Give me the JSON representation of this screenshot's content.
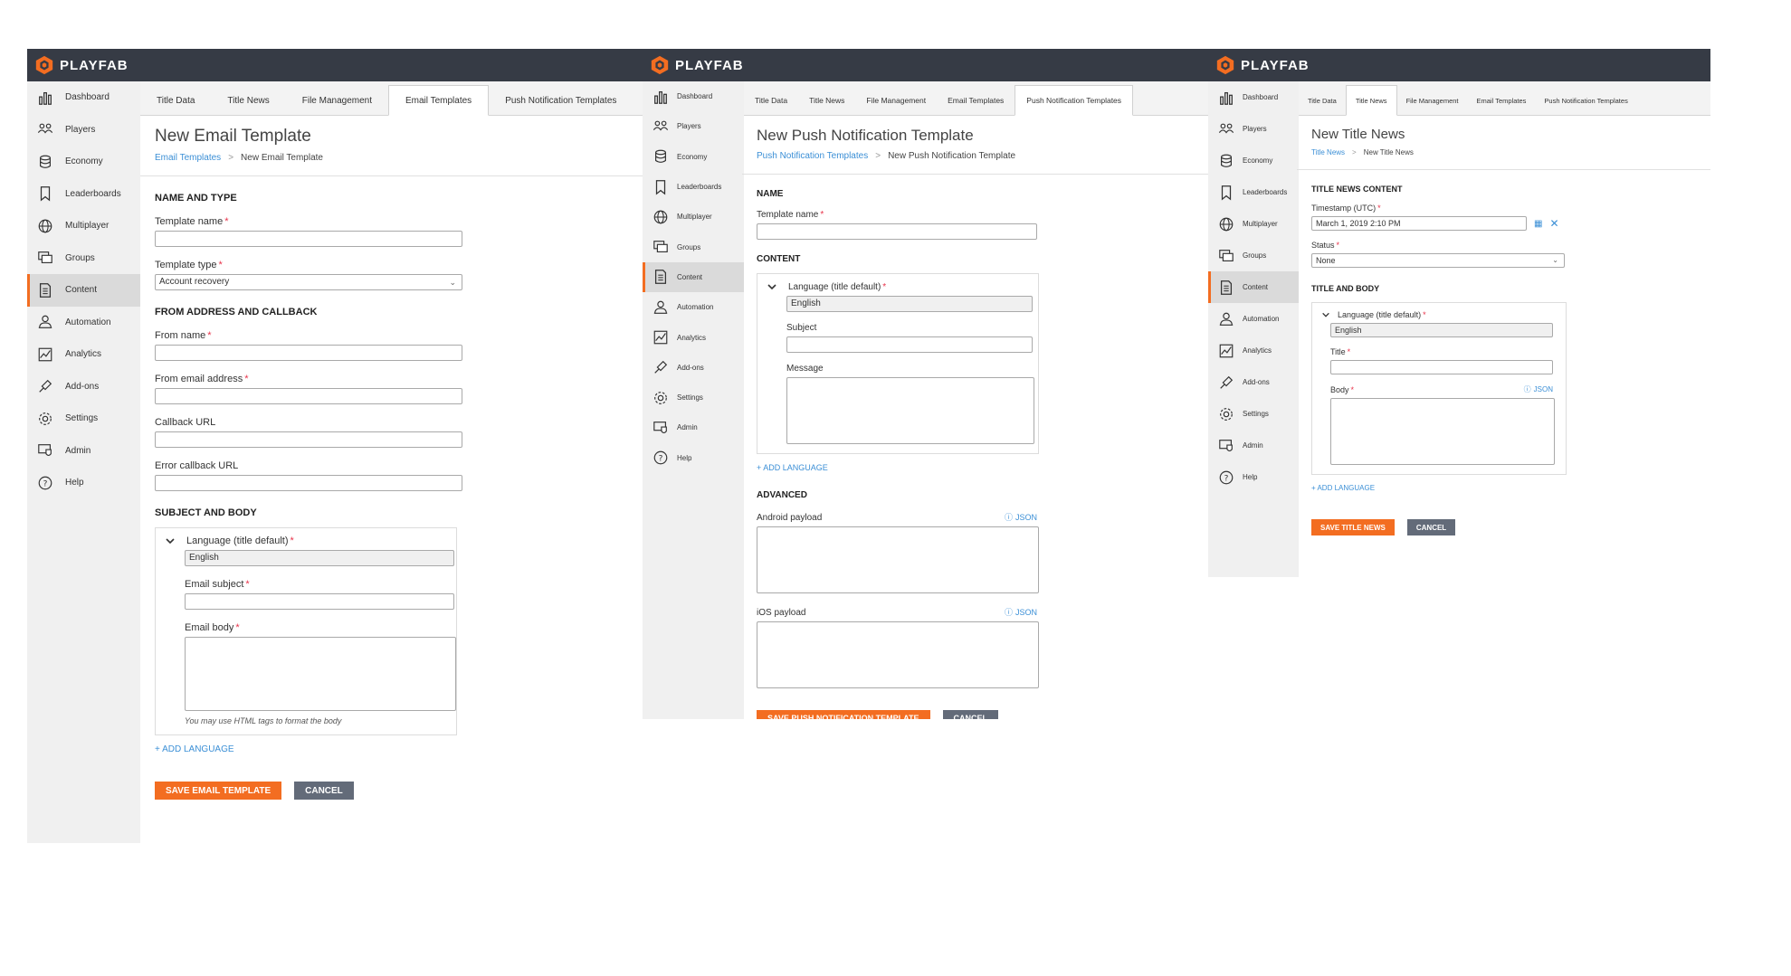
{
  "brand": {
    "name": "PLAYFAB",
    "accent": "#f36d21",
    "topbar": "#363b45"
  },
  "sidebar": {
    "items": [
      {
        "label": "Dashboard",
        "icon": "bar-chart-icon"
      },
      {
        "label": "Players",
        "icon": "players-icon"
      },
      {
        "label": "Economy",
        "icon": "database-icon"
      },
      {
        "label": "Leaderboards",
        "icon": "bookmark-icon"
      },
      {
        "label": "Multiplayer",
        "icon": "globe-icon"
      },
      {
        "label": "Groups",
        "icon": "groups-icon"
      },
      {
        "label": "Content",
        "icon": "document-icon"
      },
      {
        "label": "Automation",
        "icon": "robot-icon"
      },
      {
        "label": "Analytics",
        "icon": "analytics-icon"
      },
      {
        "label": "Add-ons",
        "icon": "plug-icon"
      },
      {
        "label": "Settings",
        "icon": "gear-icon"
      },
      {
        "label": "Admin",
        "icon": "admin-shield-icon"
      },
      {
        "label": "Help",
        "icon": "help-icon"
      }
    ],
    "active": "Content"
  },
  "tabs": [
    "Title Data",
    "Title News",
    "File Management",
    "Email Templates",
    "Push Notification Templates"
  ],
  "email": {
    "active_tab": "Email Templates",
    "title": "New Email Template",
    "crumb_link": "Email Templates",
    "crumb_current": "New Email Template",
    "sec_name_type": "NAME AND TYPE",
    "template_name_label": "Template name",
    "template_type_label": "Template type",
    "template_type_value": "Account recovery",
    "sec_from": "FROM ADDRESS AND CALLBACK",
    "from_name_label": "From name",
    "from_email_label": "From email address",
    "callback_label": "Callback URL",
    "error_callback_label": "Error callback URL",
    "sec_subject_body": "SUBJECT AND BODY",
    "language_label": "Language (title default)",
    "language_value": "English",
    "email_subject_label": "Email subject",
    "email_body_label": "Email body",
    "hint": "You may use HTML tags to format the body",
    "add_language": "+ ADD LANGUAGE",
    "save": "SAVE EMAIL TEMPLATE",
    "cancel": "CANCEL"
  },
  "push": {
    "active_tab": "Push Notification Templates",
    "title": "New Push Notification Template",
    "crumb_link": "Push Notification Templates",
    "crumb_current": "New Push Notification Template",
    "sec_name": "NAME",
    "template_name_label": "Template name",
    "sec_content": "CONTENT",
    "language_label": "Language (title default)",
    "language_value": "English",
    "subject_label": "Subject",
    "message_label": "Message",
    "add_language": "+ ADD LANGUAGE",
    "sec_advanced": "ADVANCED",
    "android_label": "Android payload",
    "ios_label": "iOS payload",
    "json": "JSON",
    "save": "SAVE PUSH NOTIFICATION TEMPLATE",
    "cancel": "CANCEL"
  },
  "news": {
    "active_tab": "Title News",
    "title": "New Title News",
    "crumb_link": "Title News",
    "crumb_current": "New Title News",
    "sec_content": "TITLE NEWS CONTENT",
    "timestamp_label": "Timestamp (UTC)",
    "timestamp_value": "March 1, 2019 2:10 PM",
    "status_label": "Status",
    "status_value": "None",
    "sec_title_body": "TITLE AND BODY",
    "language_label": "Language (title default)",
    "language_value": "English",
    "title_label": "Title",
    "body_label": "Body",
    "json": "JSON",
    "add_language": "+ ADD LANGUAGE",
    "save": "SAVE TITLE NEWS",
    "cancel": "CANCEL"
  }
}
